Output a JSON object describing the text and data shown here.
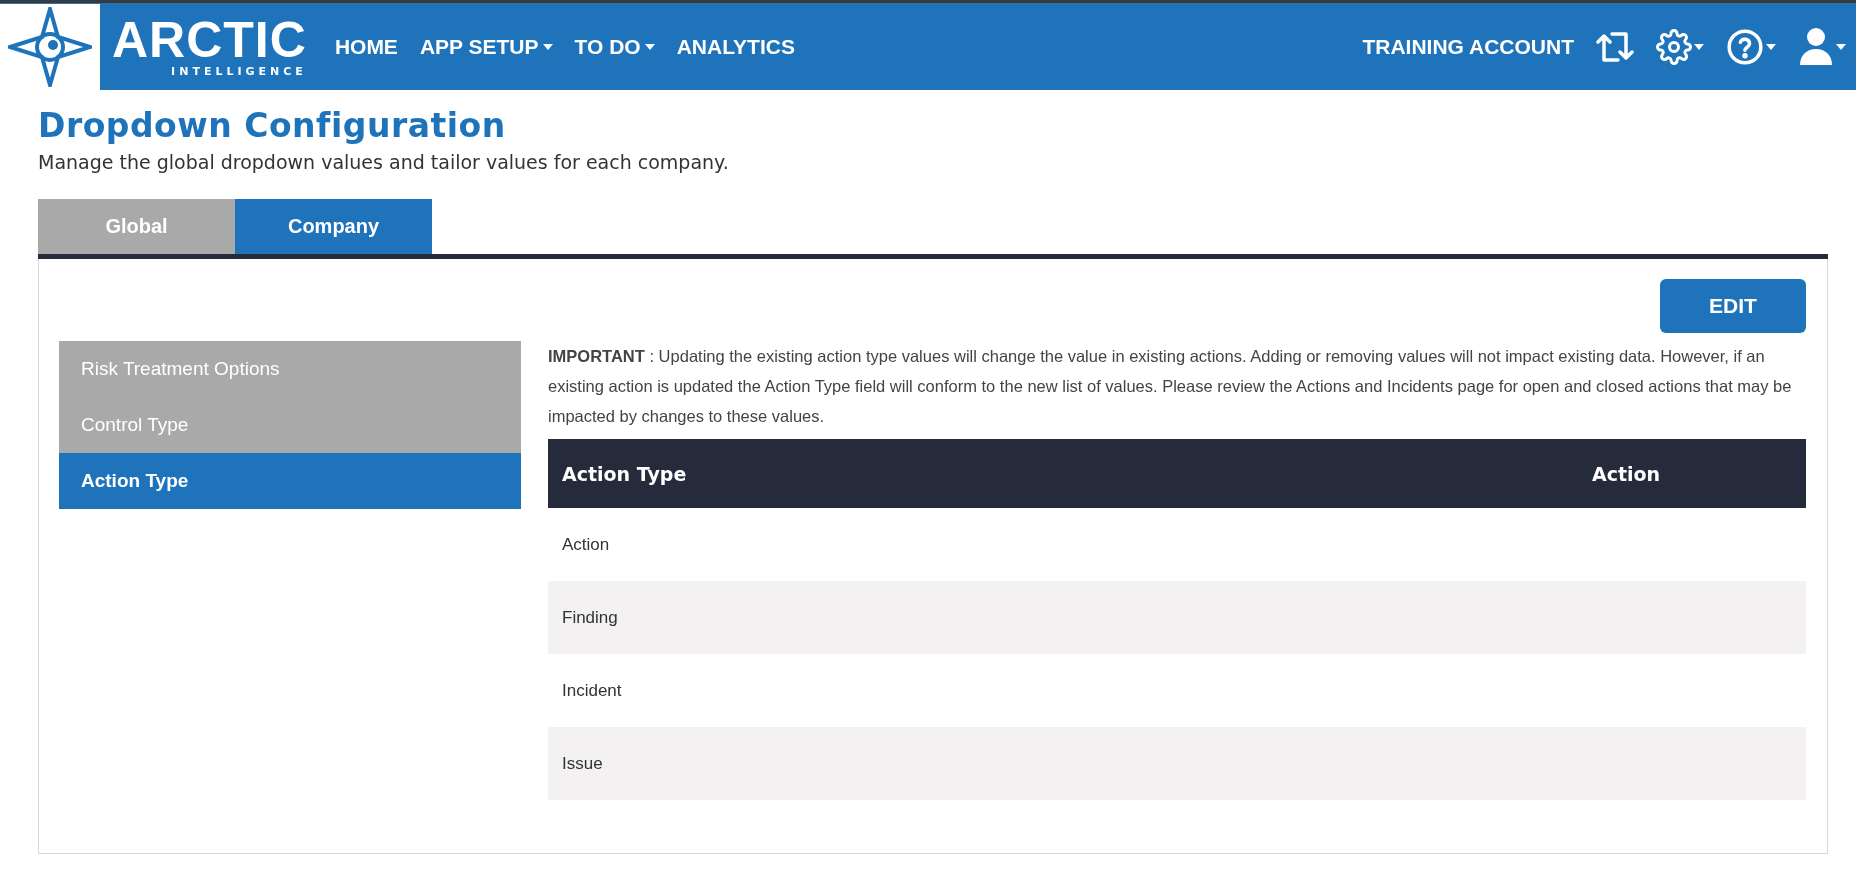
{
  "header": {
    "logo": {
      "title": "ARCTIC",
      "subtitle": "INTELLIGENCE"
    },
    "nav": [
      {
        "label": "HOME",
        "dropdown": false
      },
      {
        "label": "APP SETUP",
        "dropdown": true
      },
      {
        "label": "TO DO",
        "dropdown": true
      },
      {
        "label": "ANALYTICS",
        "dropdown": false
      }
    ],
    "account": "TRAINING ACCOUNT"
  },
  "page": {
    "title": "Dropdown Configuration",
    "subtitle": "Manage the global dropdown values and tailor values for each company."
  },
  "tabs": [
    {
      "label": "Global",
      "selected": false
    },
    {
      "label": "Company",
      "selected": true
    }
  ],
  "edit_button": "EDIT",
  "sidebar": {
    "items": [
      {
        "label": "Risk Treatment Options",
        "selected": false
      },
      {
        "label": "Control Type",
        "selected": false
      },
      {
        "label": "Action Type",
        "selected": true
      }
    ]
  },
  "notice": "**IMPORTANT** : Updating the existing action type values will change the value in existing actions. Adding or removing values will not impact existing data. However, if an existing action is updated the Action Type field will conform to the new list of values. Please review the Actions and Incidents page for open and closed actions that may be impacted by changes to these values.",
  "table": {
    "columns": [
      "Action Type",
      "Action"
    ],
    "rows": [
      {
        "cells": [
          "Action",
          ""
        ]
      },
      {
        "cells": [
          "Finding",
          ""
        ]
      },
      {
        "cells": [
          "Incident",
          ""
        ]
      },
      {
        "cells": [
          "Issue",
          ""
        ]
      }
    ]
  }
}
